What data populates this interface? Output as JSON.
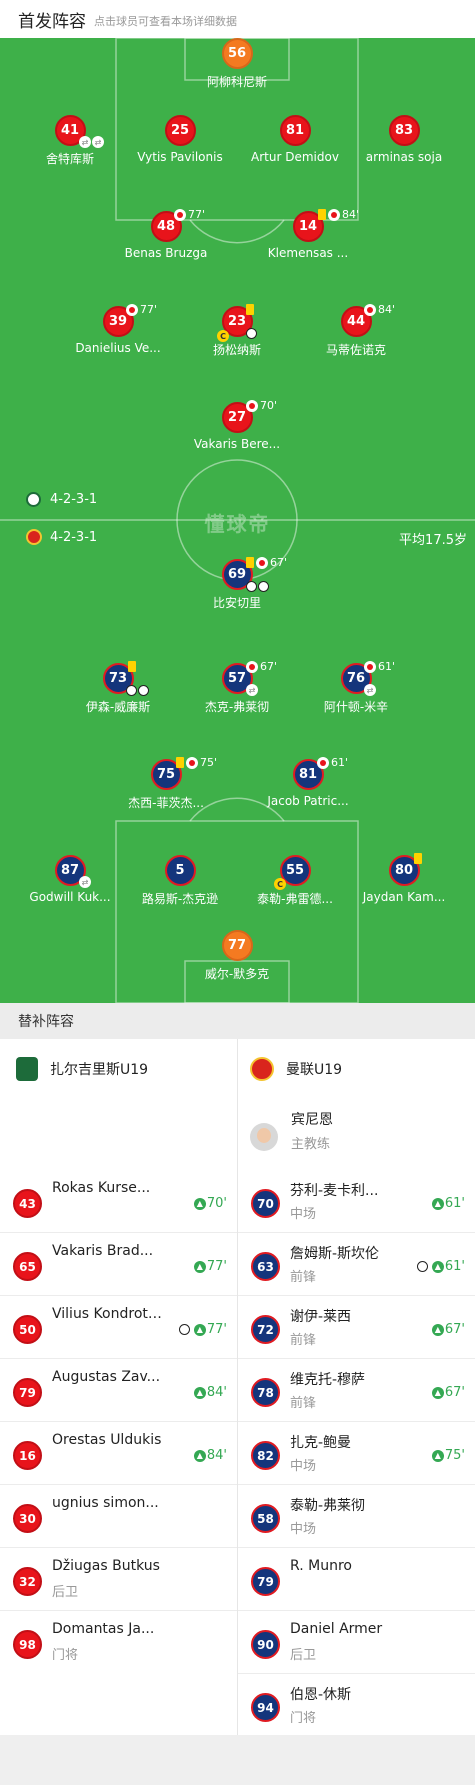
{
  "header": {
    "title": "首发阵容",
    "subtitle": "点击球员可查看本场详细数据"
  },
  "pitch": {
    "watermark": "懂球帝",
    "home_formation": "4-2-3-1",
    "away_formation": "4-2-3-1",
    "away_avg_age": "平均17.5岁",
    "home_players": [
      {
        "number": "56",
        "name": "阿柳科尼斯"
      },
      {
        "number": "41",
        "name": "舍特库斯"
      },
      {
        "number": "25",
        "name": "Vytis Pavilonis"
      },
      {
        "number": "81",
        "name": "Artur Demidov"
      },
      {
        "number": "83",
        "name": "arminas soja"
      },
      {
        "number": "48",
        "name": "Benas Bruzga",
        "minute": "77'"
      },
      {
        "number": "14",
        "name": "Klemensas ...",
        "minute": "84'"
      },
      {
        "number": "39",
        "name": "Danielius Ve...",
        "minute": "77'"
      },
      {
        "number": "23",
        "name": "扬松纳斯"
      },
      {
        "number": "44",
        "name": "马蒂佐诺克",
        "minute": "84'"
      },
      {
        "number": "27",
        "name": "Vakaris Bere...",
        "minute": "70'"
      }
    ],
    "away_players": [
      {
        "number": "69",
        "name": "比安切里",
        "minute": "67'"
      },
      {
        "number": "73",
        "name": "伊森-威廉斯"
      },
      {
        "number": "57",
        "name": "杰克-弗莱彻",
        "minute": "67'"
      },
      {
        "number": "76",
        "name": "阿什顿-米辛",
        "minute": "61'"
      },
      {
        "number": "75",
        "name": "杰西-菲茨杰...",
        "minute": "75'"
      },
      {
        "number": "81",
        "name": "Jacob Patric...",
        "minute": "61'"
      },
      {
        "number": "87",
        "name": "Godwill Kuk..."
      },
      {
        "number": "5",
        "name": "路易斯-杰克逊"
      },
      {
        "number": "55",
        "name": "泰勒-弗雷德..."
      },
      {
        "number": "80",
        "name": "Jaydan Kam..."
      },
      {
        "number": "77",
        "name": "威尔-默多克"
      }
    ],
    "captain_mark": "C",
    "colors": {
      "pitch": "#3eb049",
      "home": "#e8141b",
      "goalkeeper": "#f47a21",
      "away": "#14357c"
    }
  },
  "subs": {
    "title": "替补阵容",
    "home_team": "扎尔吉里斯U19",
    "away_team": "曼联U19",
    "coach": {
      "name": "宾尼恩",
      "role": "主教练"
    },
    "home_list": [
      {
        "number": "43",
        "name": "Rokas Kurse...",
        "position": "",
        "sub_in": "70'"
      },
      {
        "number": "65",
        "name": "Vakaris Brad...",
        "position": "",
        "sub_in": "77'"
      },
      {
        "number": "50",
        "name": "Vilius Kondrotas",
        "position": "",
        "sub_in": "77'",
        "goal": true
      },
      {
        "number": "79",
        "name": "Augustas Zav...",
        "position": "",
        "sub_in": "84'"
      },
      {
        "number": "16",
        "name": "Orestas Uldukis",
        "position": "",
        "sub_in": "84'"
      },
      {
        "number": "30",
        "name": "ugnius simon...",
        "position": "",
        "sub_in": ""
      },
      {
        "number": "32",
        "name": "Džiugas Butkus",
        "position": "后卫",
        "sub_in": ""
      },
      {
        "number": "98",
        "name": "Domantas Ja...",
        "position": "门将",
        "sub_in": ""
      }
    ],
    "away_list": [
      {
        "number": "70",
        "name": "芬利-麦卡利...",
        "position": "中场",
        "sub_in": "61'"
      },
      {
        "number": "63",
        "name": "詹姆斯-斯坎伦",
        "position": "前锋",
        "sub_in": "61'",
        "goal": true
      },
      {
        "number": "72",
        "name": "谢伊-莱西",
        "position": "前锋",
        "sub_in": "67'"
      },
      {
        "number": "78",
        "name": "维克托-穆萨",
        "position": "前锋",
        "sub_in": "67'"
      },
      {
        "number": "82",
        "name": "扎克-鲍曼",
        "position": "中场",
        "sub_in": "75'"
      },
      {
        "number": "58",
        "name": "泰勒-弗莱彻",
        "position": "中场",
        "sub_in": ""
      },
      {
        "number": "79",
        "name": "R. Munro",
        "position": "",
        "sub_in": ""
      },
      {
        "number": "90",
        "name": "Daniel Armer",
        "position": "后卫",
        "sub_in": ""
      },
      {
        "number": "94",
        "name": "伯恩-休斯",
        "position": "门将",
        "sub_in": ""
      }
    ]
  }
}
